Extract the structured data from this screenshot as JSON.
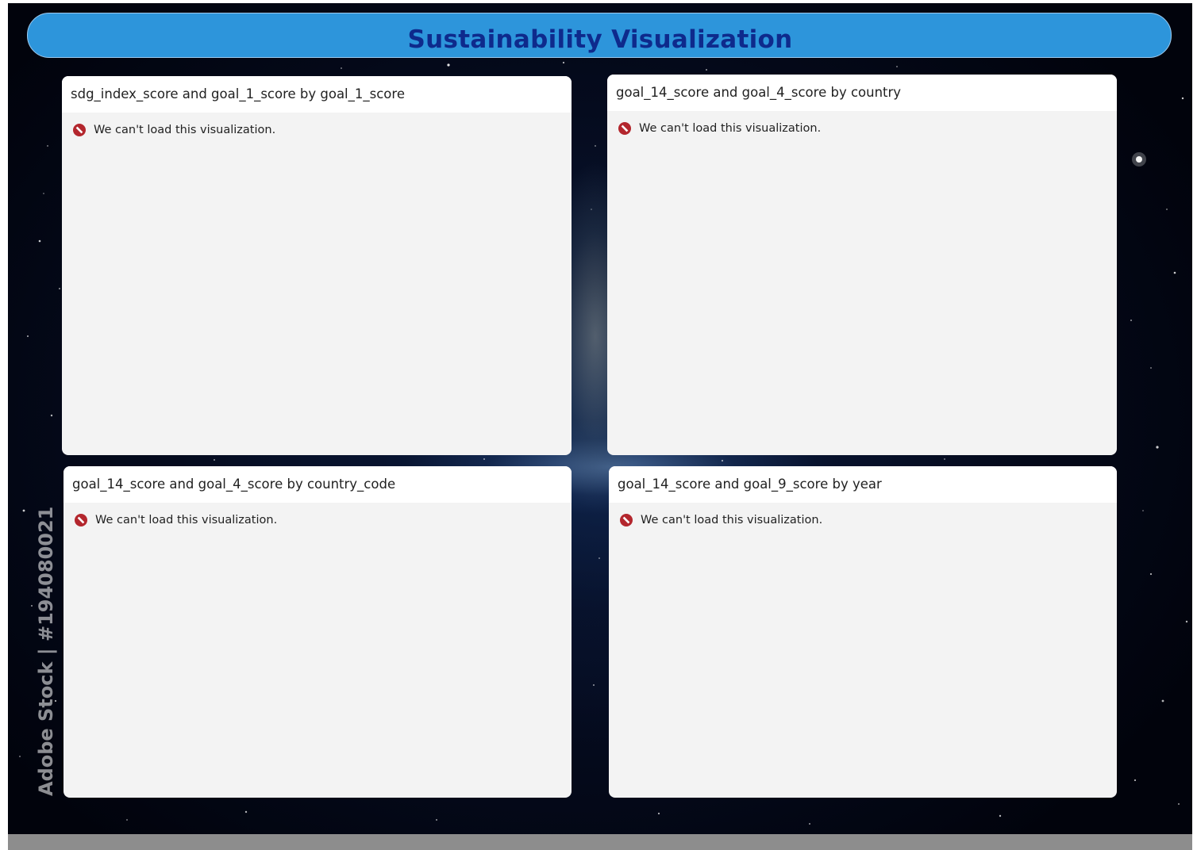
{
  "header": {
    "title": "Sustainability Visualization"
  },
  "panels": [
    {
      "title": "sdg_index_score and goal_1_score by goal_1_score",
      "error": "We can't load this visualization."
    },
    {
      "title": "goal_14_score and goal_4_score by country",
      "error": "We can't load this visualization."
    },
    {
      "title": "goal_14_score and goal_4_score by country_code",
      "error": "We can't load this visualization."
    },
    {
      "title": "goal_14_score and goal_9_score by year",
      "error": "We can't load this visualization."
    }
  ],
  "watermark": {
    "text": "Adobe Stock | #194080021"
  },
  "colors": {
    "header_bg": "#2d95db",
    "header_text": "#0e2a8c",
    "error_icon": "#b3262d",
    "panel_bg": "#f3f3f3",
    "footer_bg": "#8d8d8d"
  },
  "icons": {
    "error": "no-entry-icon"
  }
}
